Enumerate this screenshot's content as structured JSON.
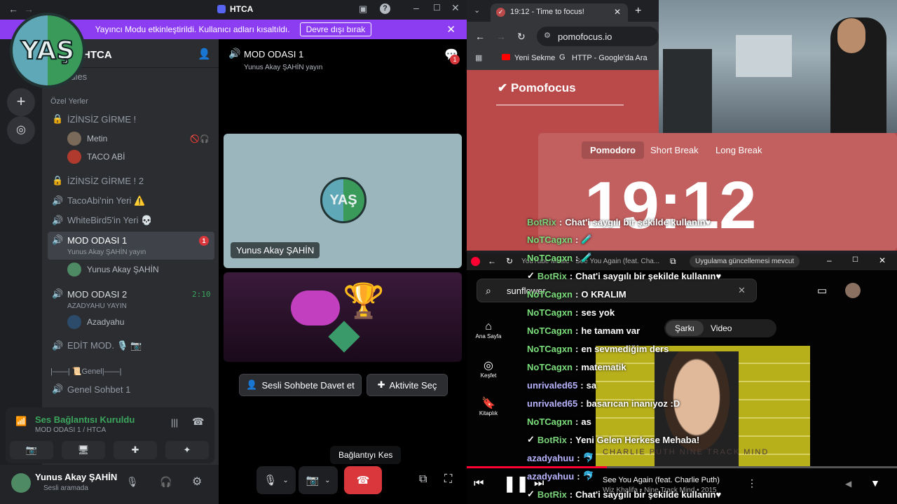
{
  "discord": {
    "title": "HTCA",
    "banner": {
      "text": "Yayıncı Modu etkinleştirildi. Kullanıcı adları kısaltıldı.",
      "button": "Devre dışı bırak"
    },
    "server_name": "HTCA",
    "rules": "rules",
    "category_private": "Özel Yerler",
    "channels": [
      {
        "name": "İZİNSİZ GİRME !"
      },
      {
        "name": "İZİNSİZ GİRME ! 2"
      },
      {
        "name": "TacoAbi'nin Yeri ⚠️"
      },
      {
        "name": "WhiteBird5'in Yeri 💀"
      },
      {
        "name": "MOD ODASI 1",
        "sub": "Yunus Akay ŞAHİN yayın",
        "badge": "1"
      },
      {
        "name": "MOD ODASI 2",
        "sub": "AZADYAHU YAYIN",
        "timer": "2:10"
      },
      {
        "name": "EDİT MOD. 🎙️ 📷"
      },
      {
        "name": "Genel Sohbet 1"
      }
    ],
    "members_ch1": [
      "Metin",
      "TACO ABİ"
    ],
    "member_mod1": "Yunus Akay ŞAHİN",
    "member_mod2": "Azadyahu",
    "category_general": "|——| 📜Genel|——|",
    "voice": {
      "status": "Ses Bağlantısı Kuruldu",
      "channel": "MOD ODASI 1 / HTCA"
    },
    "user": {
      "name": "Yunus Akay ŞAHİN",
      "status": "Sesli aramada"
    },
    "call": {
      "channel": "MOD ODASI 1",
      "stream": "Yunus Akay ŞAHİN yayın",
      "tile_name": "Yunus Akay ŞAHİN",
      "notif": "1"
    },
    "invite_btn": "Sesli Sohbete Davet et",
    "activity_btn": "Aktivite Seç",
    "disconnect_tooltip": "Bağlantıyı Kes"
  },
  "logo_text": "YAŞ",
  "chrome": {
    "tab_title": "19:12 - Time to focus!",
    "url": "pomofocus.io",
    "bookmarks": [
      "Yeni Sekme",
      "HTTP - Google'da Ara"
    ]
  },
  "pomofocus": {
    "brand": "Pomofocus",
    "tabs": [
      "Pomodoro",
      "Short Break",
      "Long Break"
    ],
    "time": "19:12"
  },
  "ytmusic": {
    "title_bar": "YouTube Music - See You Again (feat. Cha...",
    "update": "Uygulama güncellemesi mevcut",
    "search": "sunflower",
    "nav": [
      "Ana Sayfa",
      "Keşfet",
      "Kitaplık"
    ],
    "toggle": [
      "Şarkı",
      "Video"
    ],
    "album_text": "CHARLIE PUTH NINE TRACK MIND",
    "song": "See You Again (feat. Charlie Puth)",
    "artist": "Wiz Khalifa • Nine Track Mind • 2015"
  },
  "chat": [
    {
      "name": "BotRix",
      "msg": "Chat'i saygılı bir şekilde kullanın♥"
    },
    {
      "name": "NoTCagxn",
      "msg": "🧪"
    },
    {
      "name": "NoTCagxn",
      "msg": "🧪"
    },
    {
      "name": "BotRix",
      "msg": "Chat'i saygılı bir şekilde kullanın♥"
    },
    {
      "name": "NoTCagxn",
      "msg": "O KRALIM"
    },
    {
      "name": "NoTCagxn",
      "msg": "ses yok"
    },
    {
      "name": "NoTCagxn",
      "msg": "he tamam var"
    },
    {
      "name": "NoTCagxn",
      "msg": "en sevmediğim ders"
    },
    {
      "name": "NoTCagxn",
      "msg": "matematik"
    },
    {
      "name": "unrivaled65",
      "msg": "sa"
    },
    {
      "name": "unrivaled65",
      "msg": "basarıcan inanıyoz :D"
    },
    {
      "name": "NoTCagxn",
      "msg": "as"
    },
    {
      "name": "BotRix",
      "msg": "Yeni Gelen Herkese Mehaba!"
    },
    {
      "name": "azadyahuu",
      "msg": "🐬"
    },
    {
      "name": "azadyahuu",
      "msg": "🐬"
    },
    {
      "name": "BotRix",
      "msg": "Chat'i saygılı bir şekilde kullanın♥"
    }
  ]
}
